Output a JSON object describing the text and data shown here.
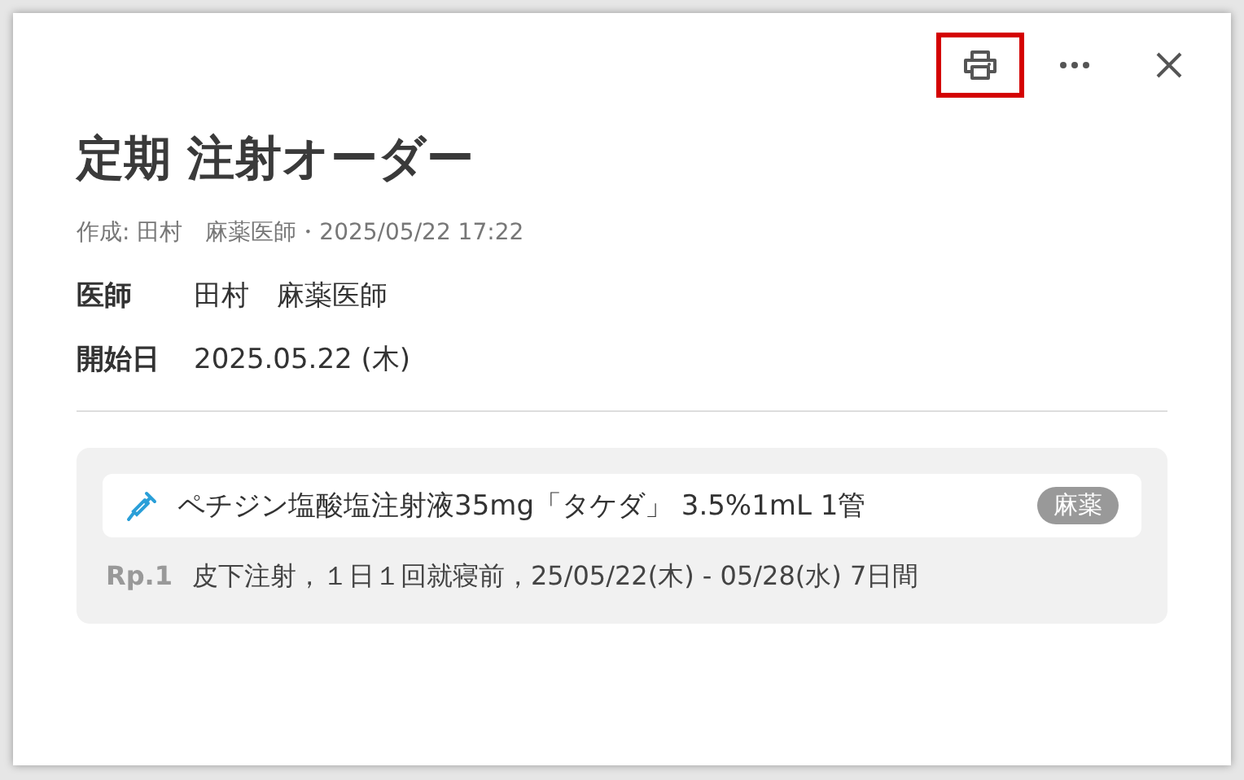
{
  "toolbar": [
    {
      "kind": "print",
      "highlighted": true
    },
    {
      "kind": "more",
      "highlighted": false
    },
    {
      "kind": "close",
      "highlighted": false
    }
  ],
  "title": "定期 注射オーダー",
  "meta": "作成: 田村　麻薬医師・2025/05/22 17:22",
  "fields": [
    {
      "label": "医師",
      "value": "田村　麻薬医師"
    },
    {
      "label": "開始日",
      "value": "2025.05.22 (木)"
    }
  ],
  "prescription": {
    "drug": "ペチジン塩酸塩注射液35mg「タケダ」 3.5%1mL  1管",
    "tag": "麻薬",
    "rp": "Rp.1",
    "instruction": "皮下注射，１日１回就寝前，25/05/22(木) - 05/28(水) 7日間"
  }
}
